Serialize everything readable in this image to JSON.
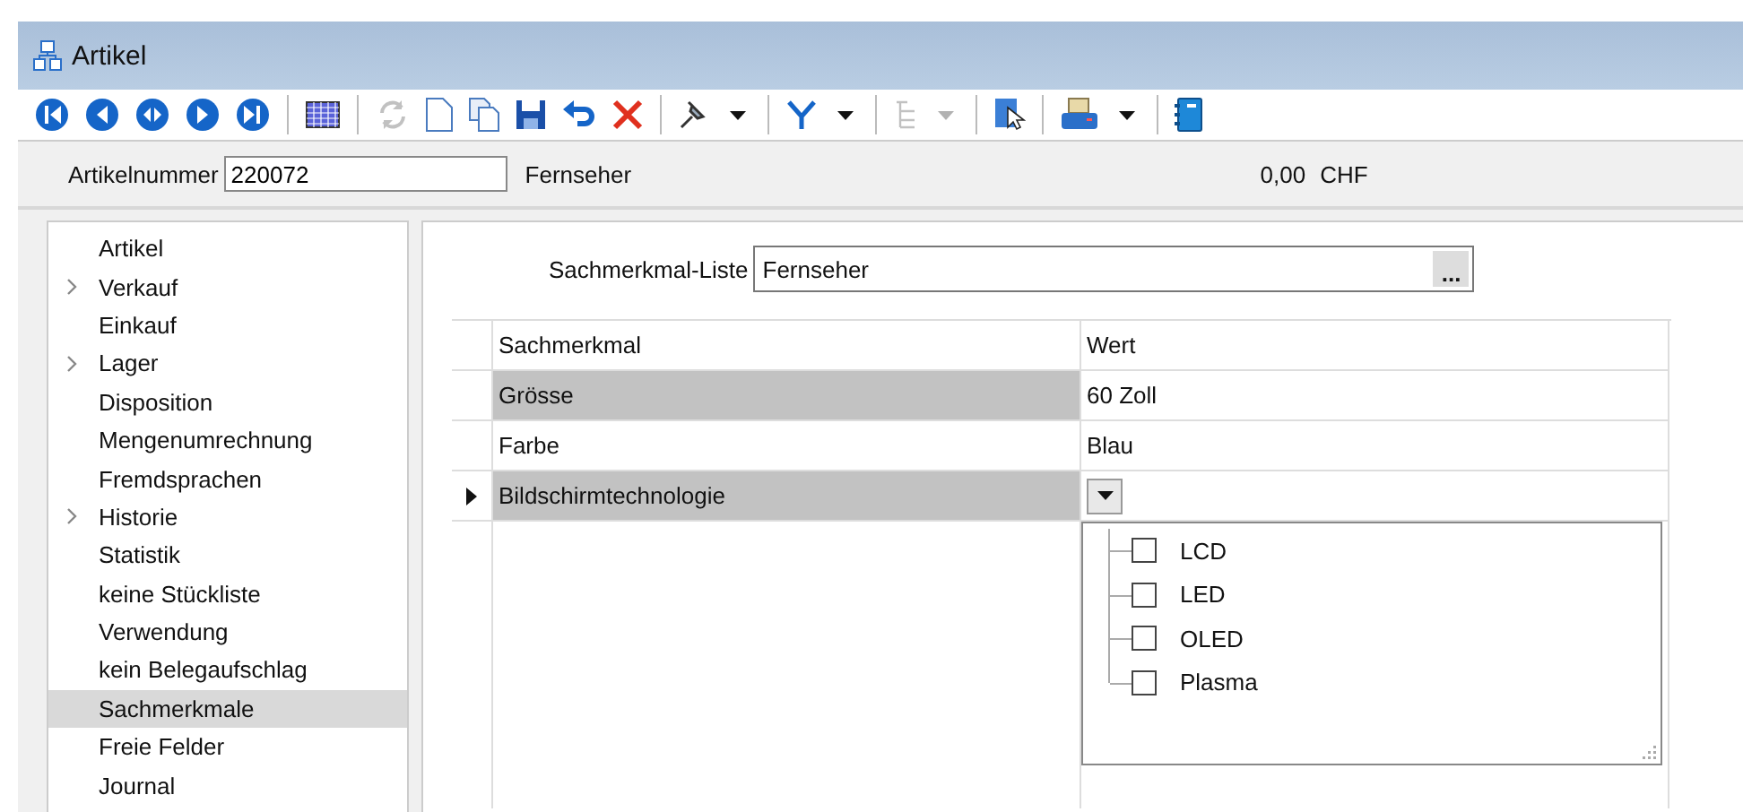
{
  "window": {
    "title": "Artikel"
  },
  "toolbar": [
    {
      "kind": "first",
      "disabled": false
    },
    {
      "kind": "prev",
      "disabled": false
    },
    {
      "kind": "jump",
      "disabled": false
    },
    {
      "kind": "next",
      "disabled": false
    },
    {
      "kind": "last",
      "disabled": false
    },
    {
      "kind": "sep"
    },
    {
      "kind": "grid",
      "disabled": false
    },
    {
      "kind": "sep"
    },
    {
      "kind": "refresh",
      "disabled": true
    },
    {
      "kind": "new",
      "disabled": false
    },
    {
      "kind": "copy",
      "disabled": false
    },
    {
      "kind": "save",
      "disabled": false
    },
    {
      "kind": "undo",
      "disabled": false
    },
    {
      "kind": "delete",
      "disabled": false
    },
    {
      "kind": "sep"
    },
    {
      "kind": "pin",
      "disabled": false
    },
    {
      "kind": "caret",
      "disabled": false
    },
    {
      "kind": "sep"
    },
    {
      "kind": "filter",
      "disabled": false
    },
    {
      "kind": "caret",
      "disabled": false
    },
    {
      "kind": "sep"
    },
    {
      "kind": "tree",
      "disabled": true
    },
    {
      "kind": "caret",
      "disabled": true
    },
    {
      "kind": "sep"
    },
    {
      "kind": "pointer",
      "disabled": false
    },
    {
      "kind": "sep"
    },
    {
      "kind": "print",
      "disabled": false
    },
    {
      "kind": "caret",
      "disabled": false
    },
    {
      "kind": "sep"
    },
    {
      "kind": "book",
      "disabled": false
    }
  ],
  "header": {
    "label": "Artikelnummer",
    "value": "220072",
    "name": "Fernseher",
    "amount": "0,00",
    "currency": "CHF"
  },
  "sidebar": {
    "items": [
      {
        "label": "Artikel",
        "expandable": false,
        "selected": false
      },
      {
        "label": "Verkauf",
        "expandable": true,
        "selected": false
      },
      {
        "label": "Einkauf",
        "expandable": false,
        "selected": false
      },
      {
        "label": "Lager",
        "expandable": true,
        "selected": false
      },
      {
        "label": "Disposition",
        "expandable": false,
        "selected": false
      },
      {
        "label": "Mengenumrechnung",
        "expandable": false,
        "selected": false
      },
      {
        "label": "Fremdsprachen",
        "expandable": false,
        "selected": false
      },
      {
        "label": "Historie",
        "expandable": true,
        "selected": false
      },
      {
        "label": "Statistik",
        "expandable": false,
        "selected": false
      },
      {
        "label": "keine Stückliste",
        "expandable": false,
        "selected": false
      },
      {
        "label": "Verwendung",
        "expandable": false,
        "selected": false
      },
      {
        "label": "kein Belegaufschlag",
        "expandable": false,
        "selected": false
      },
      {
        "label": "Sachmerkmale",
        "expandable": false,
        "selected": true
      },
      {
        "label": "Freie Felder",
        "expandable": false,
        "selected": false
      },
      {
        "label": "Journal",
        "expandable": false,
        "selected": false
      }
    ]
  },
  "list_field": {
    "label": "Sachmerkmal-Liste",
    "value": "Fernseher",
    "button": "..."
  },
  "table": {
    "columns": [
      "Sachmerkmal",
      "Wert"
    ],
    "rows": [
      {
        "name": "Grösse",
        "value": "60 Zoll",
        "shaded": true,
        "current": false
      },
      {
        "name": "Farbe",
        "value": "Blau",
        "shaded": false,
        "current": false
      },
      {
        "name": "Bildschirmtechnologie",
        "value": "",
        "shaded": true,
        "current": true
      }
    ]
  },
  "dropdown": {
    "options": [
      {
        "label": "LCD",
        "checked": false
      },
      {
        "label": "LED",
        "checked": false
      },
      {
        "label": "OLED",
        "checked": false
      },
      {
        "label": "Plasma",
        "checked": false
      }
    ]
  }
}
